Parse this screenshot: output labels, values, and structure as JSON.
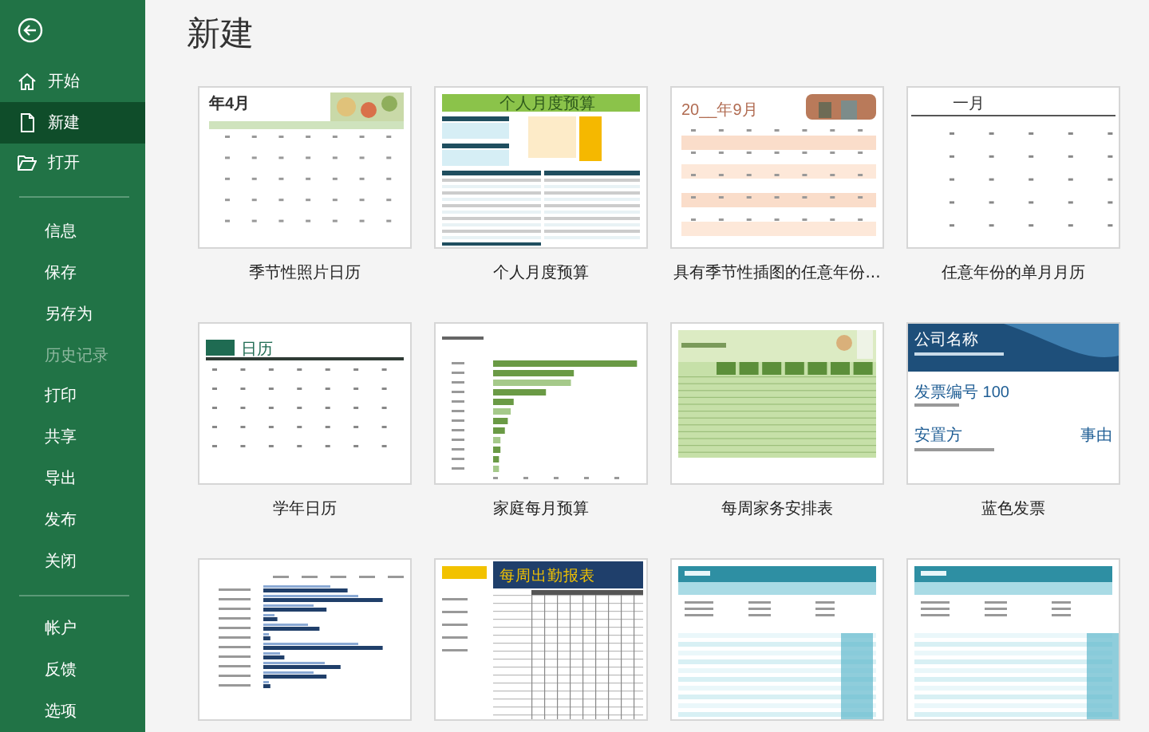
{
  "sidebar": {
    "nav": [
      {
        "label": "开始",
        "selected": false
      },
      {
        "label": "新建",
        "selected": true
      },
      {
        "label": "打开",
        "selected": false
      }
    ],
    "groups": [
      [
        {
          "label": "信息",
          "disabled": false
        },
        {
          "label": "保存",
          "disabled": false
        },
        {
          "label": "另存为",
          "disabled": false
        },
        {
          "label": "历史记录",
          "disabled": true
        },
        {
          "label": "打印",
          "disabled": false
        },
        {
          "label": "共享",
          "disabled": false
        },
        {
          "label": "导出",
          "disabled": false
        },
        {
          "label": "发布",
          "disabled": false
        },
        {
          "label": "关闭",
          "disabled": false
        }
      ],
      [
        {
          "label": "帐户",
          "disabled": false
        },
        {
          "label": "反馈",
          "disabled": false
        },
        {
          "label": "选项",
          "disabled": false
        }
      ]
    ]
  },
  "page_title": "新建",
  "templates": [
    {
      "kind": "photo-calendar",
      "label": "季节性照片日历",
      "texts": [
        "年4月"
      ]
    },
    {
      "kind": "budget",
      "label": "个人月度预算",
      "texts": [
        "个人月度预算"
      ]
    },
    {
      "kind": "seasonal-calendar",
      "label": "具有季节性插图的任意年份...",
      "texts": [
        "20__年9月"
      ]
    },
    {
      "kind": "month-calendar",
      "label": "任意年份的单月月历",
      "texts": [
        "一月"
      ]
    },
    {
      "kind": "school-calendar",
      "label": "学年日历",
      "texts": [
        "日历"
      ]
    },
    {
      "kind": "bar-chart",
      "label": "家庭每月预算"
    },
    {
      "kind": "chores",
      "label": "每周家务安排表"
    },
    {
      "kind": "invoice",
      "label": "蓝色发票",
      "texts": [
        "公司名称",
        "发票编号 100",
        "安置方",
        "事由"
      ]
    },
    {
      "kind": "inventory"
    },
    {
      "kind": "timesheet",
      "texts": [
        "每周出勤报表"
      ]
    },
    {
      "kind": "rental"
    },
    {
      "kind": "rental-ext"
    }
  ]
}
